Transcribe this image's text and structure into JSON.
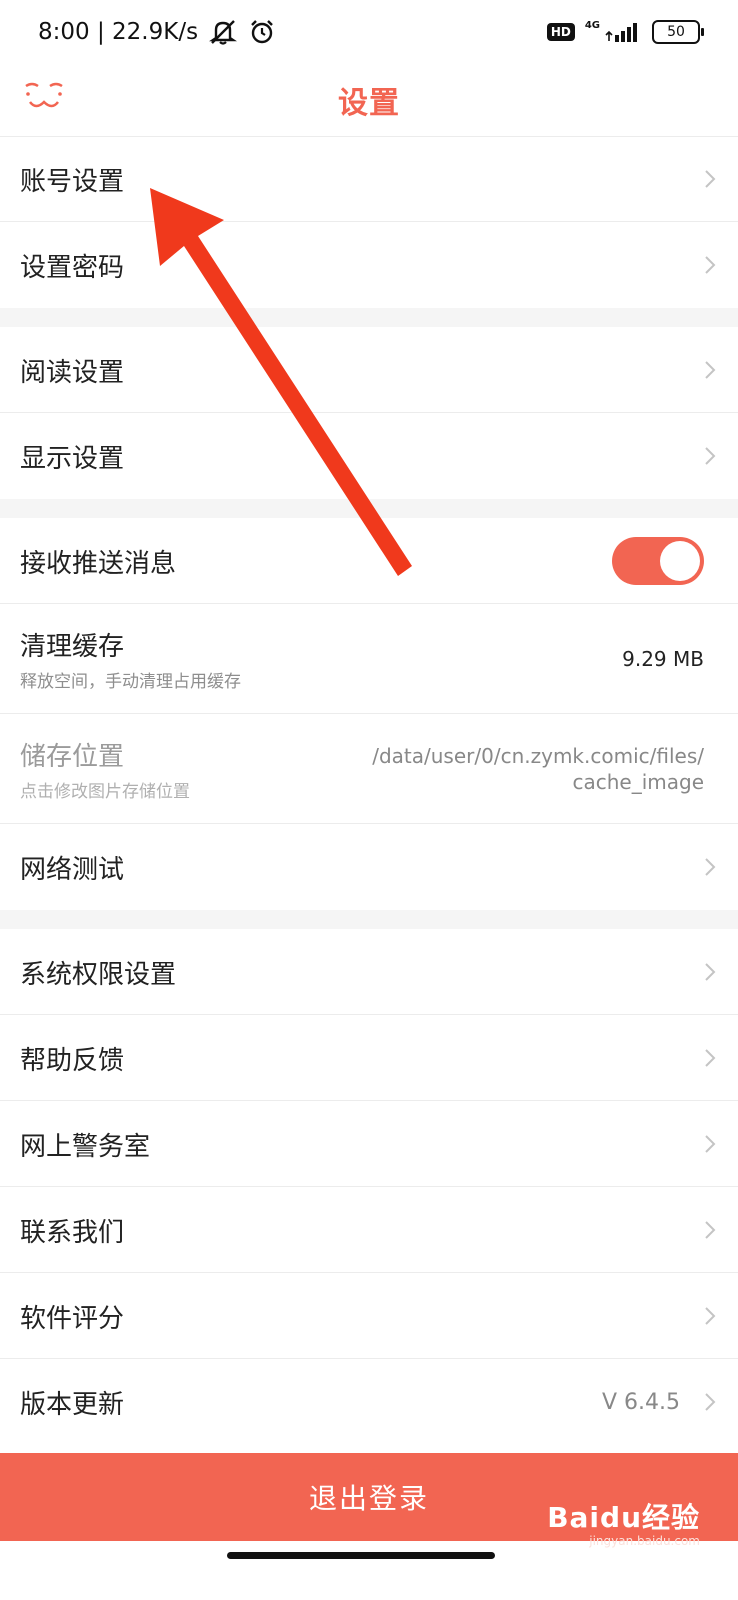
{
  "status_bar": {
    "time_speed": "8:00 | 22.9K/s",
    "hd": "HD",
    "network": "4G",
    "battery": "50"
  },
  "header": {
    "title": "设置",
    "logo_icon": "cat-face-icon"
  },
  "accent_color": "#f26552",
  "settings": {
    "account": "账号设置",
    "password": "设置密码",
    "reading": "阅读设置",
    "display": "显示设置",
    "push": {
      "label": "接收推送消息",
      "enabled": true
    },
    "cache": {
      "label": "清理缓存",
      "sub": "释放空间，手动清理占用缓存",
      "value": "9.29 MB"
    },
    "storage": {
      "label": "储存位置",
      "sub": "点击修改图片存储位置",
      "path_line1": "/data/user/0/cn.zymk.comic/files/",
      "path_line2": "cache_image"
    },
    "network_test": "网络测试",
    "permissions": "系统权限设置",
    "feedback": "帮助反馈",
    "police": "网上警务室",
    "contact": "联系我们",
    "rating": "软件评分",
    "version": {
      "label": "版本更新",
      "value": "V 6.4.5"
    }
  },
  "logout_label": "退出登录",
  "watermark": {
    "main": "Baidu经验",
    "sub": "jingyan.baidu.com"
  }
}
